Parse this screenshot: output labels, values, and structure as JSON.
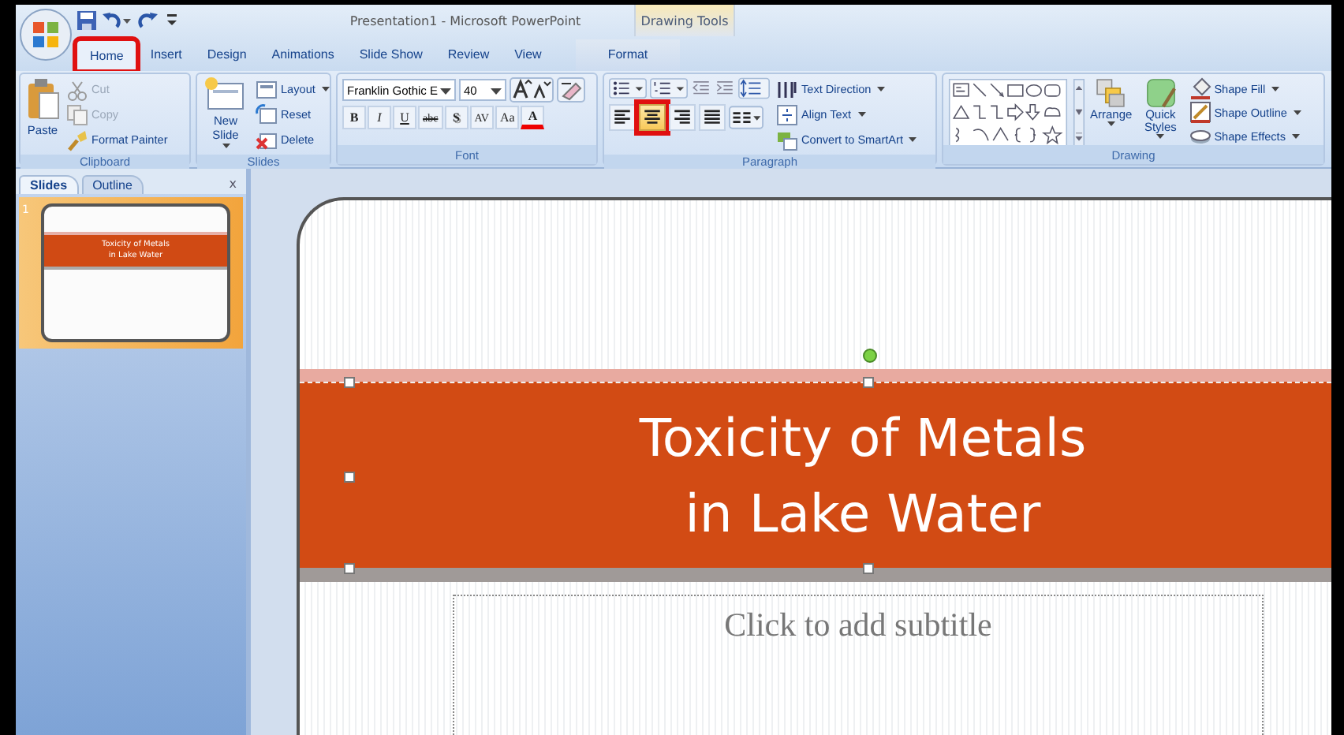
{
  "window": {
    "title": "Presentation1 - Microsoft PowerPoint"
  },
  "contextual_tab_group": {
    "title": "Drawing Tools"
  },
  "tabs": [
    {
      "label": "Home",
      "selected": true,
      "highlighted": true,
      "contextual": false
    },
    {
      "label": "Insert",
      "selected": false,
      "highlighted": false,
      "contextual": false
    },
    {
      "label": "Design",
      "selected": false,
      "highlighted": false,
      "contextual": false
    },
    {
      "label": "Animations",
      "selected": false,
      "highlighted": false,
      "contextual": false
    },
    {
      "label": "Slide Show",
      "selected": false,
      "highlighted": false,
      "contextual": false
    },
    {
      "label": "Review",
      "selected": false,
      "highlighted": false,
      "contextual": false
    },
    {
      "label": "View",
      "selected": false,
      "highlighted": false,
      "contextual": false
    },
    {
      "label": "Format",
      "selected": false,
      "highlighted": false,
      "contextual": true
    }
  ],
  "ribbon": {
    "clipboard": {
      "title": "Clipboard",
      "paste": "Paste",
      "commands": [
        {
          "label": "Cut",
          "disabled": true
        },
        {
          "label": "Copy",
          "disabled": true
        },
        {
          "label": "Format Painter",
          "disabled": false
        }
      ]
    },
    "slides": {
      "title": "Slides",
      "new_slide": "New Slide",
      "commands": [
        {
          "label": "Layout",
          "dropdown": true
        },
        {
          "label": "Reset",
          "dropdown": false
        },
        {
          "label": "Delete",
          "dropdown": false
        }
      ]
    },
    "font": {
      "title": "Font",
      "font_name": "Franklin Gothic E",
      "font_size": "40",
      "format_buttons": [
        {
          "kind": "bold",
          "label": "B"
        },
        {
          "kind": "italic",
          "label": "I"
        },
        {
          "kind": "underline",
          "label": "U"
        },
        {
          "kind": "strike",
          "label": "abc"
        },
        {
          "kind": "shadow",
          "label": "S"
        },
        {
          "kind": "spacing",
          "label": "AV"
        },
        {
          "kind": "case",
          "label": "Aa"
        },
        {
          "kind": "color",
          "label": "A"
        }
      ]
    },
    "paragraph": {
      "title": "Paragraph",
      "alignment": [
        {
          "selected": false,
          "highlighted": false
        },
        {
          "selected": true,
          "highlighted": true
        },
        {
          "selected": false,
          "highlighted": false
        },
        {
          "selected": false,
          "highlighted": false
        }
      ],
      "commands": [
        {
          "label": "Text Direction"
        },
        {
          "label": "Align Text"
        },
        {
          "label": "Convert to SmartArt"
        }
      ]
    },
    "drawing": {
      "title": "Drawing",
      "arrange": "Arrange",
      "quick_styles": "Quick Styles",
      "commands": [
        {
          "label": "Shape Fill"
        },
        {
          "label": "Shape Outline"
        },
        {
          "label": "Shape Effects"
        }
      ]
    }
  },
  "slides_pane": {
    "tabs": [
      {
        "label": "Slides",
        "selected": true
      },
      {
        "label": "Outline",
        "selected": false
      }
    ],
    "close": "x",
    "thumbnails": [
      {
        "number": "1",
        "selected": true,
        "title": "Toxicity of Metals\nin Lake Water"
      }
    ]
  },
  "slide": {
    "title": "Toxicity of Metals\nin Lake Water",
    "title_selected": true,
    "subtitle_placeholder": "Click to add subtitle"
  }
}
